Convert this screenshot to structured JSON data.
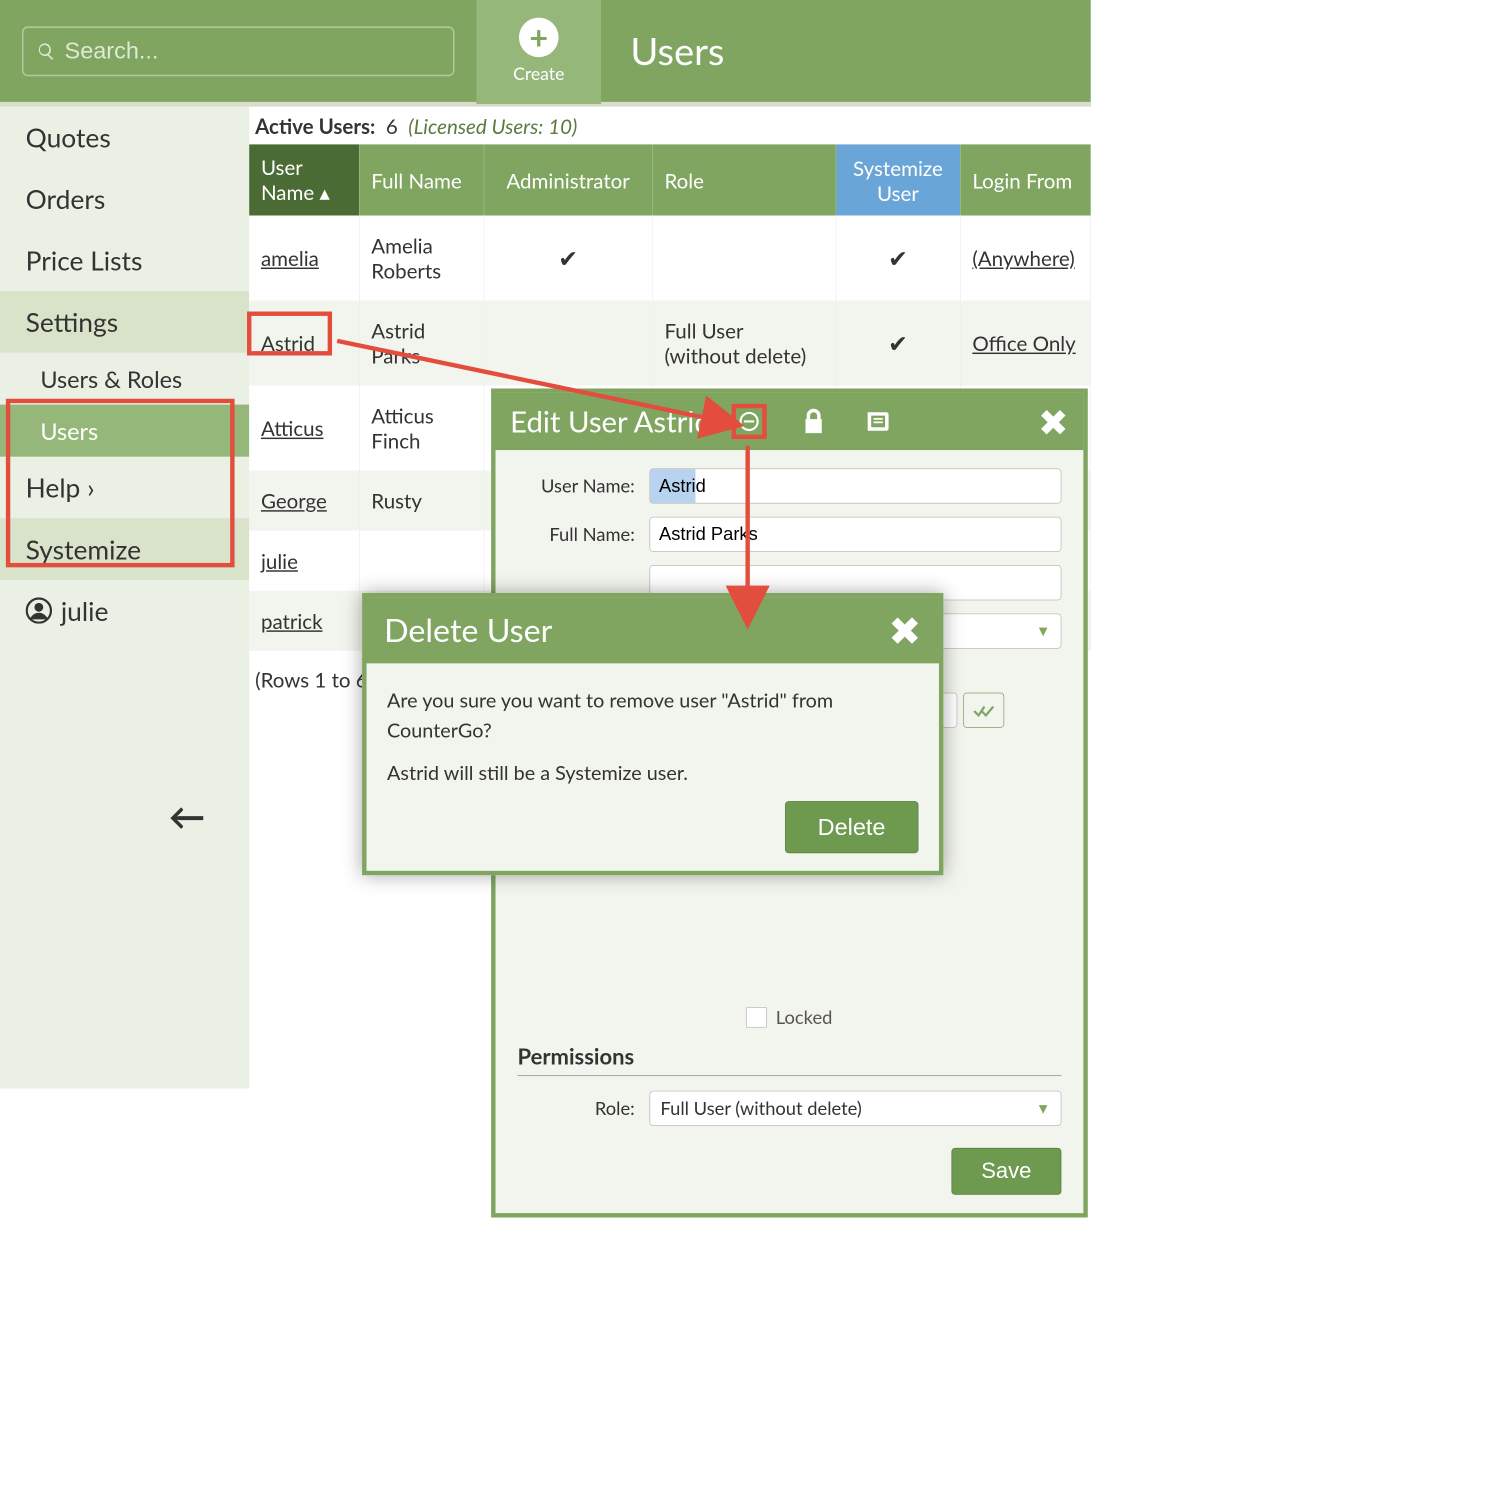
{
  "header": {
    "search_placeholder": "Search...",
    "create_label": "Create",
    "page_title": "Users"
  },
  "sidebar": {
    "items": [
      "Quotes",
      "Orders",
      "Price Lists",
      "Settings",
      "Users & Roles",
      "Users",
      "Help",
      "Systemize"
    ],
    "current_user": "julie"
  },
  "active_users": {
    "label": "Active Users:",
    "count": "6",
    "licensed": "(Licensed Users: 10)"
  },
  "table": {
    "headers": [
      "User Name",
      "Full Name",
      "Administrator",
      "Role",
      "Systemize User",
      "Login From"
    ],
    "rows": [
      {
        "uname": "amelia",
        "fname": "Amelia Roberts",
        "admin": true,
        "role": "",
        "sys": true,
        "login": "(Anywhere)"
      },
      {
        "uname": "Astrid",
        "fname": "Astrid Parks",
        "admin": false,
        "role": "Full User (without delete)",
        "sys": true,
        "login": "Office Only"
      },
      {
        "uname": "Atticus",
        "fname": "Atticus Finch",
        "admin": false,
        "role": "",
        "sys": false,
        "login": ""
      },
      {
        "uname": "George",
        "fname": "Rusty",
        "admin": false,
        "role": "",
        "sys": false,
        "login": ""
      },
      {
        "uname": "julie",
        "fname": "",
        "admin": false,
        "role": "",
        "sys": false,
        "login": ""
      },
      {
        "uname": "patrick",
        "fname": "",
        "admin": false,
        "role": "",
        "sys": false,
        "login": ""
      }
    ],
    "rows_text": "(Rows 1 to 6"
  },
  "edit": {
    "title": "Edit User Astrid",
    "username_lbl": "User Name:",
    "username_val": "Astrid",
    "fullname_lbl": "Full Name:",
    "fullname_val": "Astrid Parks",
    "locked_lbl": "Locked",
    "perm_hdr": "Permissions",
    "role_lbl": "Role:",
    "role_val": "Full User (without delete)",
    "save_lbl": "Save"
  },
  "del": {
    "title": "Delete User",
    "line1": "Are you sure you want to remove user \"Astrid\" from CounterGo?",
    "line2": "Astrid will still be a Systemize user.",
    "btn": "Delete"
  }
}
